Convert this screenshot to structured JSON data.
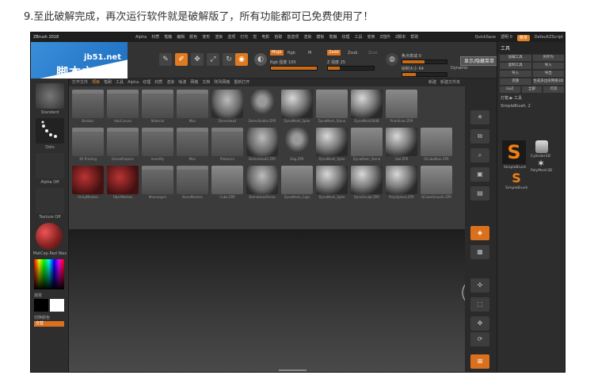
{
  "caption": "9.至此破解完成，再次运行软件就是破解版了，所有功能都可已免费使用了！",
  "app": {
    "title": "ZBrush 2018",
    "menus": [
      "Alpha",
      "材质",
      "笔触",
      "编辑",
      "颜色",
      "变形",
      "渲染",
      "选项",
      "灯光",
      "宏",
      "电影",
      "拾取",
      "首选项",
      "渲染",
      "模板",
      "笔触",
      "纹理",
      "工具",
      "变换",
      "Z插件",
      "Z脚本",
      "帮助"
    ],
    "quicksave": "QuickSave",
    "see_through": "透明 0",
    "menus_btn": "菜单",
    "script": "DefaultZScript"
  },
  "watermark": {
    "url": "jb51.net",
    "name": "脚本之家"
  },
  "toolbar": {
    "popup_button": "显示/隐藏菜单",
    "mrgb": "Mrgb",
    "rgb": "Rgb",
    "m": "M",
    "zadd": "Zadd",
    "zsub": "Zsub",
    "zcut": "Zcut",
    "rgb_intensity": "Rgb 强度 100",
    "z_intensity": "Z 强度 25",
    "focal_shift": "焦点衰减 0",
    "draw_size": "绘制大小 64",
    "dynamic": "Dynamic",
    "edit_label": "编辑",
    "draw_label": "绘制",
    "move_label": "移动",
    "scale_label": "缩放",
    "rotate_label": "旋转"
  },
  "left_panel": {
    "items": [
      "Standard",
      "Dots",
      "Alpha Off",
      "Texture Off",
      "MatCap Red Wax"
    ],
    "gradient": "渐变",
    "switch_color": "切换颜色",
    "alternate": "交替"
  },
  "lightbox": {
    "tabs": [
      "打开文件",
      "项目",
      "笔刷",
      "工具",
      "Alpha",
      "纹理",
      "材质",
      "渲染",
      "噪波",
      "网格",
      "文档",
      "阵列网格",
      "重新打开"
    ],
    "active_tab": "项目",
    "right_tabs": [
      "新建",
      "新建文件夹"
    ],
    "items": [
      {
        "name": "Bonbon",
        "kind": "folder"
      },
      {
        "name": "HairCurves",
        "kind": "folder"
      },
      {
        "name": "Material",
        "kind": "folder"
      },
      {
        "name": "Misc",
        "kind": "folder"
      },
      {
        "name": "DemoHead",
        "kind": "head"
      },
      {
        "name": "DemoSoldier.ZPR",
        "kind": "figure"
      },
      {
        "name": "DynaMesh_Sphe",
        "kind": "sphere"
      },
      {
        "name": "DynaMesh_Stone",
        "kind": "flat"
      },
      {
        "name": "DynaMesh2048",
        "kind": "sphere"
      },
      {
        "name": "Primitives.ZPR",
        "kind": "flat"
      },
      {
        "name": "",
        "kind": "none"
      },
      {
        "name": "3D Printing",
        "kind": "folder"
      },
      {
        "name": "DemoProjects",
        "kind": "folder"
      },
      {
        "name": "Insertlty",
        "kind": "folder"
      },
      {
        "name": "Misc",
        "kind": "folder"
      },
      {
        "name": "Platonics",
        "kind": "folder"
      },
      {
        "name": "DemoHead2.ZPR",
        "kind": "head"
      },
      {
        "name": "Dog.ZPR",
        "kind": "figure"
      },
      {
        "name": "DynaMesh_Sphe",
        "kind": "sphere"
      },
      {
        "name": "DynaMesh_Stone",
        "kind": "flat"
      },
      {
        "name": "Owl.ZPR",
        "kind": "sphere"
      },
      {
        "name": "QCubeBlue.ZPR",
        "kind": "flat"
      },
      {
        "name": "ArrayMeshes",
        "kind": "red"
      },
      {
        "name": "FiberMeshes",
        "kind": "red"
      },
      {
        "name": "Mannequin",
        "kind": "folder"
      },
      {
        "name": "NanoMeshes",
        "kind": "folder"
      },
      {
        "name": "Cube.ZPR",
        "kind": "flat"
      },
      {
        "name": "DemoHeadFema",
        "kind": "head"
      },
      {
        "name": "DynaMesh_Caps",
        "kind": "flat"
      },
      {
        "name": "DynaMesh_Sphe",
        "kind": "sphere"
      },
      {
        "name": "DynaSculpt.ZPR",
        "kind": "sphere"
      },
      {
        "name": "PolySphere.ZPR",
        "kind": "sphere"
      },
      {
        "name": "QCubeSmooth.ZPR",
        "kind": "flat"
      }
    ]
  },
  "tool_panel": {
    "title": "工具",
    "rows": [
      [
        "加载工具",
        "另存为"
      ],
      [
        "复制工具",
        "导入"
      ],
      [
        "导入",
        "导出"
      ],
      [
        "克隆",
        "生成多边形网格3D"
      ],
      [
        "GoZ",
        "全部",
        "可见"
      ]
    ],
    "lightbox_label": "灯箱 ▶ 工具",
    "simple_brush": "SimpleBrush. 2",
    "brushes": [
      "SimpleBrush",
      "Cylinder3D",
      "PolyMesh3D",
      "SimpleBrush"
    ]
  }
}
